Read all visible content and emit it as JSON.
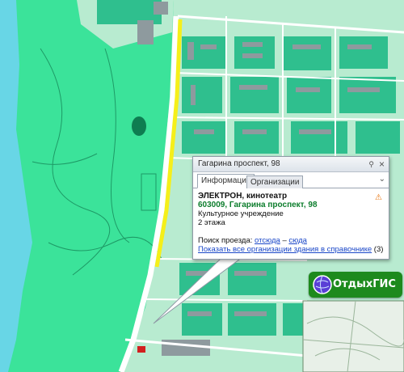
{
  "popup": {
    "title": "Гагарина проспект, 98",
    "close_icon": "×",
    "pin_icon": "⚲",
    "tabs": [
      {
        "label": "Информация",
        "active": true
      },
      {
        "label": "Организации",
        "active": false
      }
    ],
    "scroll_icon": "⌄",
    "org_name": "ЭЛЕКТРОН, кинотеатр",
    "address": "603009, Гагарина проспект, 98",
    "category": "Культурное учреждение",
    "floors": "2 этажа",
    "route_label": "Поиск проезда:",
    "route_from": "отсюда",
    "route_dash": "–",
    "route_to": "сюда",
    "show_all_link": "Показать все организации здания в справочнике",
    "show_all_count": "(3)",
    "warning_icon": "⚠"
  },
  "logo": {
    "text": "ОтдыхГИС"
  },
  "colors": {
    "forest": "#3be39a",
    "water": "#68d6e6",
    "urban": "#b8ebd0",
    "block": "#2fbf8e",
    "building": "#9aa4a8",
    "road": "#ffffff",
    "highlight_road": "#f5ef1a",
    "link": "#1a47c8",
    "address_green": "#0c7d2c"
  }
}
